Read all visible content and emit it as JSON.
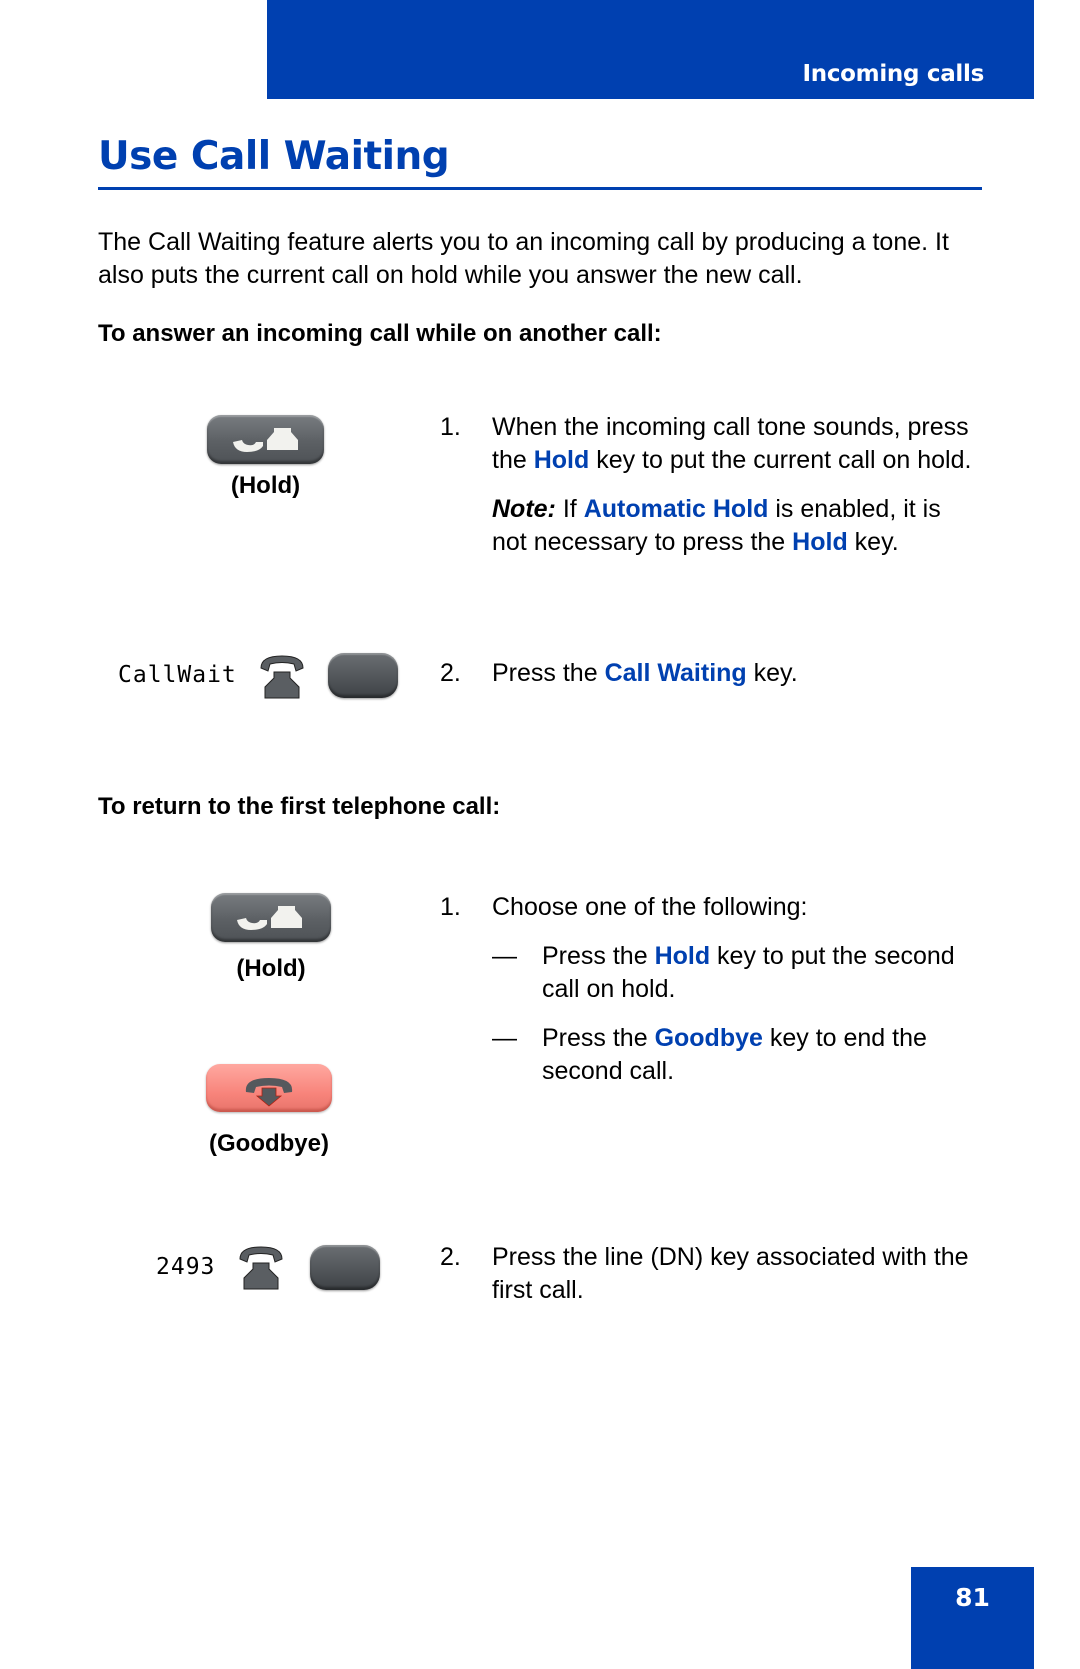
{
  "header": {
    "section_title": "Incoming calls"
  },
  "page": {
    "title": "Use Call Waiting",
    "intro": "The Call Waiting feature alerts you to an incoming call by producing a tone. It also puts the current call on hold while you answer the new call.",
    "number": "81"
  },
  "colors": {
    "brand_blue": "#0040b0",
    "goodbye_key": "#f8857c",
    "key_gray": "#5c6064"
  },
  "section1": {
    "heading": "To answer an incoming call while on another call:",
    "hold_key_label": "(Hold)",
    "lcd_label": "CallWait",
    "step1": {
      "num": "1.",
      "t1": "When the incoming call tone sounds, press the ",
      "k1": "Hold",
      "t2": " key to put the current call on hold.",
      "note_label": "Note:",
      "n1": " If ",
      "nk1": "Automatic Hold",
      "n2": " is enabled, it is not necessary to press the ",
      "nk2": "Hold",
      "n3": " key."
    },
    "step2": {
      "num": "2.",
      "t1": "Press the ",
      "k1": "Call Waiting",
      "t2": " key."
    }
  },
  "section2": {
    "heading": "To return to the first telephone call:",
    "hold_key_label": "(Hold)",
    "goodbye_key_label": "(Goodbye)",
    "lcd_label": "2493",
    "step1": {
      "num": "1.",
      "t1": "Choose one of the following:",
      "options": [
        {
          "dash": "—",
          "t1": "Press the ",
          "k1": "Hold",
          "t2": " key to put the second call on hold."
        },
        {
          "dash": "—",
          "t1": "Press the ",
          "k1": "Goodbye",
          "t2": " key to end the second call."
        }
      ]
    },
    "step2": {
      "num": "2.",
      "t1": "Press the line (DN) key associated with the first call."
    }
  },
  "icons": {
    "hold": "hold-key-icon",
    "goodbye": "goodbye-key-icon",
    "phone": "telephone-icon",
    "line_key": "line-key"
  }
}
